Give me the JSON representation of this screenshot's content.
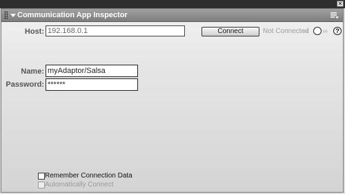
{
  "window": {
    "close_glyph": "✕"
  },
  "panel": {
    "title": "Communication App Inspector"
  },
  "form": {
    "host_label": "Host:",
    "host_value": "192.168.0.1",
    "name_label": "Name:",
    "name_value": "myAdaptor/Salsa",
    "password_label": "Password:",
    "password_value": "******"
  },
  "connection": {
    "connect_label": "Connect",
    "status_text": "Not Connected",
    "help_glyph": "?"
  },
  "options": {
    "remember_label": "Remember Connection Data",
    "remember_checked": false,
    "auto_connect_label": "Automatically Connect",
    "auto_connect_enabled": false
  },
  "icons": {
    "close": "close-icon",
    "grip": "gripper-icon",
    "collapse": "collapse-triangle-icon",
    "options_menu": "panel-options-icon",
    "status_led": "status-indicator-icon",
    "help": "help-icon"
  }
}
